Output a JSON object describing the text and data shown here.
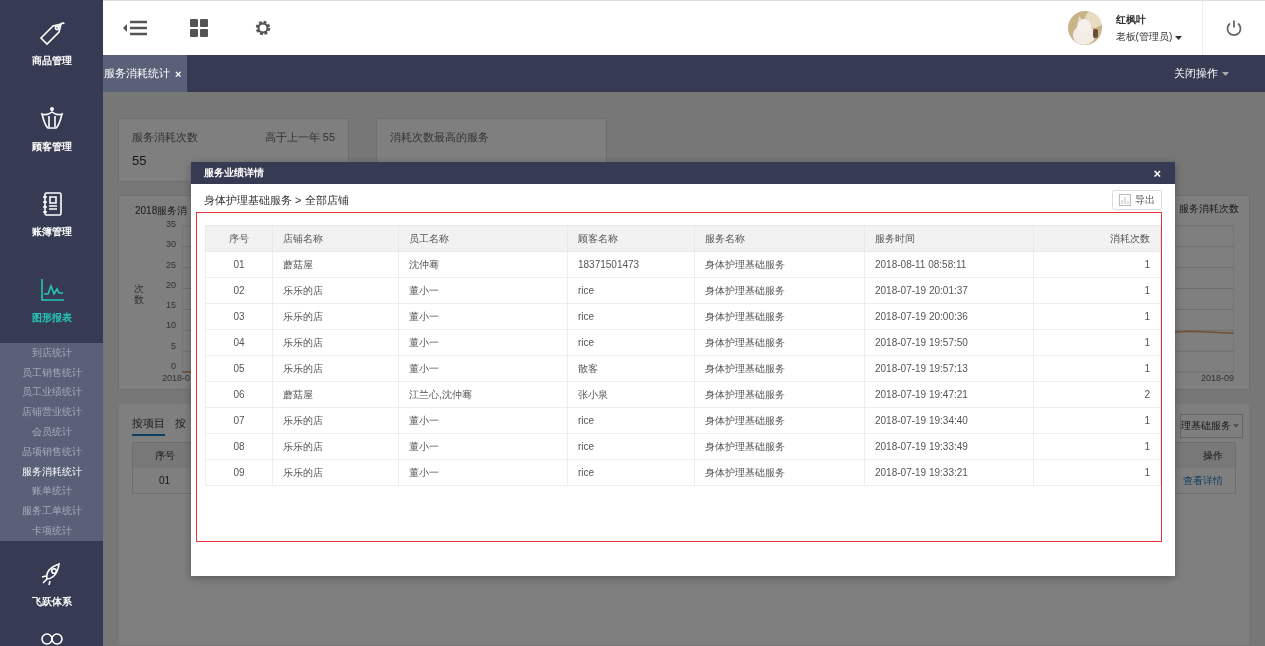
{
  "sidebar": {
    "items": [
      {
        "kind": "tag",
        "label": "商品管理",
        "selected": false
      },
      {
        "kind": "crown",
        "label": "顾客管理",
        "selected": false
      },
      {
        "kind": "book",
        "label": "账簿管理",
        "selected": false
      },
      {
        "kind": "chart",
        "label": "图形报表",
        "selected": true,
        "children": [
          {
            "label": "到店统计",
            "selected": false
          },
          {
            "label": "员工销售统计",
            "selected": false
          },
          {
            "label": "员工业绩统计",
            "selected": false
          },
          {
            "label": "店铺营业统计",
            "selected": false
          },
          {
            "label": "会员统计",
            "selected": false
          },
          {
            "label": "品项销售统计",
            "selected": false
          },
          {
            "label": "服务消耗统计",
            "selected": true
          },
          {
            "label": "账单统计",
            "selected": false
          },
          {
            "label": "服务工单统计",
            "selected": false
          },
          {
            "label": "卡项统计",
            "selected": false
          }
        ]
      },
      {
        "kind": "rocket",
        "label": "飞跃体系",
        "selected": false
      },
      {
        "kind": "people"
      }
    ]
  },
  "user": {
    "name": "红枫叶",
    "role": "老板(管理员)"
  },
  "tabs": [
    {
      "label": "服务消耗统计",
      "close": "×",
      "selected": true
    }
  ],
  "close_menu": "关闭操作",
  "background": {
    "stat_cards": [
      {
        "title": "服务消耗次数",
        "extra": "高于上一年 55",
        "value": "55"
      },
      {
        "title": "消耗次数最高的服务"
      }
    ],
    "chart": {
      "title": "2018服务消",
      "ylabel": "次数",
      "yticks": [
        "35",
        "30",
        "25",
        "20",
        "15",
        "10",
        "5",
        "0"
      ],
      "xlabels": [
        "2018-0",
        "2018-09"
      ],
      "legend": "服务消耗次数"
    },
    "detail": {
      "tabs": [
        {
          "label": "按项目",
          "selected": true
        },
        {
          "label": "按",
          "selected": false
        }
      ],
      "select": "理基础服务",
      "columns": [
        "序号",
        "操作"
      ],
      "rows": [
        {
          "index": "01",
          "action": "查看详情"
        }
      ]
    }
  },
  "modal": {
    "title": "服务业绩详情",
    "close": "×",
    "breadcrumb": "身体护理基础服务 > 全部店铺",
    "export": "导出",
    "columns": [
      "序号",
      "店铺名称",
      "员工名称",
      "顾客名称",
      "服务名称",
      "服务时间",
      "消耗次数"
    ],
    "rows": [
      [
        "01",
        "蘑菇屋",
        "沈仲骞",
        "18371501473",
        "身体护理基础服务",
        "2018-08-11 08:58:11",
        "1"
      ],
      [
        "02",
        "乐乐的店",
        "董小一",
        "rice",
        "身体护理基础服务",
        "2018-07-19 20:01:37",
        "1"
      ],
      [
        "03",
        "乐乐的店",
        "董小一",
        "rice",
        "身体护理基础服务",
        "2018-07-19 20:00:36",
        "1"
      ],
      [
        "04",
        "乐乐的店",
        "董小一",
        "rice",
        "身体护理基础服务",
        "2018-07-19 19:57:50",
        "1"
      ],
      [
        "05",
        "乐乐的店",
        "董小一",
        "散客",
        "身体护理基础服务",
        "2018-07-19 19:57:13",
        "1"
      ],
      [
        "06",
        "蘑菇屋",
        "江兰心,沈仲骞",
        "张小泉",
        "身体护理基础服务",
        "2018-07-19 19:47:21",
        "2"
      ],
      [
        "07",
        "乐乐的店",
        "董小一",
        "rice",
        "身体护理基础服务",
        "2018-07-19 19:34:40",
        "1"
      ],
      [
        "08",
        "乐乐的店",
        "董小一",
        "rice",
        "身体护理基础服务",
        "2018-07-19 19:33:49",
        "1"
      ],
      [
        "09",
        "乐乐的店",
        "董小一",
        "rice",
        "身体护理基础服务",
        "2018-07-19 19:33:21",
        "1"
      ]
    ]
  }
}
